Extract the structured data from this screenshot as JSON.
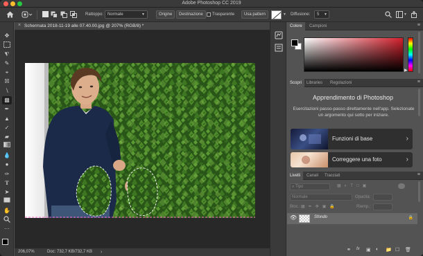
{
  "app": {
    "title": "Adobe Photoshop CC 2019"
  },
  "window_controls": {
    "close_color": "#fe5f57",
    "minimize_color": "#febc2e",
    "zoom_color": "#28c840"
  },
  "options_bar": {
    "home_icon": "home-icon",
    "tool_preset_icon": "patch-tool-icon",
    "selection_mode_icons": [
      "new-selection-icon",
      "add-to-selection-icon",
      "subtract-from-selection-icon",
      "intersect-selection-icon"
    ],
    "patch_label": "Rattoppo:",
    "patch_value": "Normale",
    "source_label": "Origine",
    "destination_label": "Destinazione",
    "transparent_label": "Trasparente",
    "use_pattern_label": "Usa pattern",
    "diffusion_label": "Diffusione:",
    "diffusion_value": "5"
  },
  "document": {
    "tab_title": "Schermata 2018-11-19 alle 07.40.00.jpg @ 207% (RGB/8) *",
    "zoom": "206,07%",
    "doc_info": "Doc: 732,7 KB/732,7 KB"
  },
  "color_panel": {
    "tabs": [
      "Colore",
      "Campioni"
    ],
    "active_tab": "Colore",
    "hue_color": "#d31f2b"
  },
  "learn_panel": {
    "tabs": [
      "Scopri",
      "Libraries",
      "Regolazioni"
    ],
    "active_tab": "Scopri",
    "heading": "Apprendimento di Photoshop",
    "description": "Esercitazioni passo-passo direttamente nell'app. Selezionate un argomento qui sotto per iniziare.",
    "cards": [
      {
        "label": "Funzioni di base"
      },
      {
        "label": "Correggere una foto"
      }
    ]
  },
  "layers_panel": {
    "tabs": [
      "Livelli",
      "Canali",
      "Tracciati"
    ],
    "active_tab": "Livelli",
    "filter_kind": "Tipo",
    "blend_mode": "Normale",
    "opacity_label": "Opacità:",
    "lock_label": "Bloc.:",
    "fill_label": "Riemp.:",
    "layers": [
      {
        "name": "Sfondo",
        "visible": true,
        "locked": true
      }
    ]
  }
}
